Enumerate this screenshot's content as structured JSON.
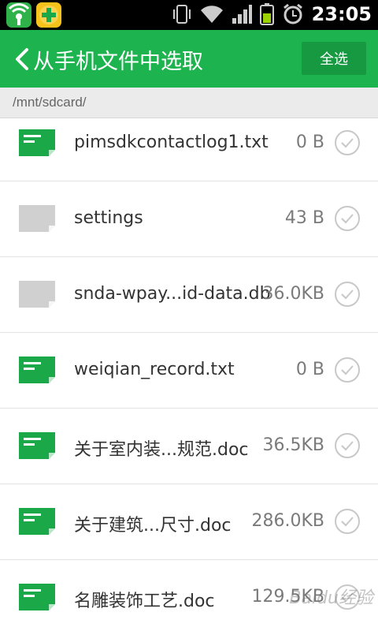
{
  "status_bar": {
    "time": "23:05",
    "icons": [
      "app-icon-green",
      "app-icon-yellow",
      "vibrate-icon",
      "wifi-icon",
      "signal-icon",
      "battery-icon",
      "alarm-icon"
    ]
  },
  "header": {
    "title": "从手机文件中选取",
    "select_all_label": "全选"
  },
  "path": "/mnt/sdcard/",
  "colors": {
    "accent": "#1db34f",
    "accent_dark": "#169941",
    "file_icon_green": "#1aa849",
    "file_icon_gray": "#d0d0d0"
  },
  "files": [
    {
      "name": "pimsdkcontactlog1.txt",
      "size": "0 B",
      "icon": "green-document-icon"
    },
    {
      "name": "settings",
      "size": "43 B",
      "icon": "gray-file-icon"
    },
    {
      "name": "snda-wpay...id-data.db",
      "size": "36.0KB",
      "icon": "gray-file-icon"
    },
    {
      "name": "weiqian_record.txt",
      "size": "0 B",
      "icon": "green-document-icon"
    },
    {
      "name": "关于室内装...规范.doc",
      "size": "36.5KB",
      "icon": "green-document-icon"
    },
    {
      "name": "关于建筑...尺寸.doc",
      "size": "286.0KB",
      "icon": "green-document-icon"
    },
    {
      "name": "名雕装饰工艺.doc",
      "size": "129.5KB",
      "icon": "green-document-icon"
    }
  ],
  "watermark": "Baidu经验"
}
